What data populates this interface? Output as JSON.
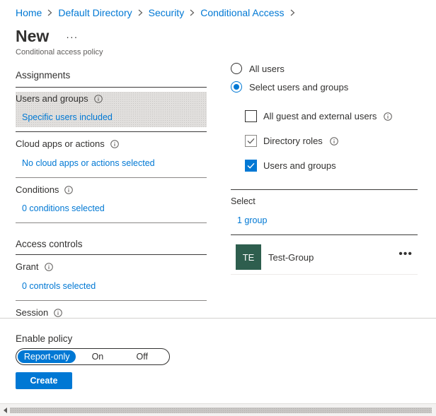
{
  "breadcrumb": {
    "items": [
      "Home",
      "Default Directory",
      "Security",
      "Conditional Access"
    ]
  },
  "header": {
    "title": "New",
    "more": "···",
    "subtitle": "Conditional access policy"
  },
  "assignments": {
    "heading": "Assignments",
    "users_groups": {
      "label": "Users and groups",
      "value": "Specific users included"
    },
    "cloud_apps": {
      "label": "Cloud apps or actions",
      "value": "No cloud apps or actions selected"
    },
    "conditions": {
      "label": "Conditions",
      "value": "0 conditions selected"
    }
  },
  "access_controls": {
    "heading": "Access controls",
    "grant": {
      "label": "Grant",
      "value": "0 controls selected"
    },
    "session": {
      "label": "Session"
    }
  },
  "include": {
    "radio_all": "All users",
    "radio_select": "Select users and groups",
    "selected_radio": "Select users and groups",
    "check_guest": {
      "label": "All guest and external users",
      "checked": false
    },
    "check_roles": {
      "label": "Directory roles",
      "checked": true
    },
    "check_users_groups": {
      "label": "Users and groups",
      "checked": true
    }
  },
  "select": {
    "label": "Select",
    "count": "1 group",
    "groups": [
      {
        "initials": "TE",
        "name": "Test-Group",
        "avatar_color": "#2e5e4e",
        "more": "•••"
      }
    ]
  },
  "footer": {
    "enable_label": "Enable policy",
    "options": [
      "Report-only",
      "On",
      "Off"
    ],
    "selected": "Report-only",
    "create_label": "Create"
  },
  "colors": {
    "accent": "#0078d4",
    "text": "#323130",
    "selected_bg": "#e1dfdd"
  }
}
